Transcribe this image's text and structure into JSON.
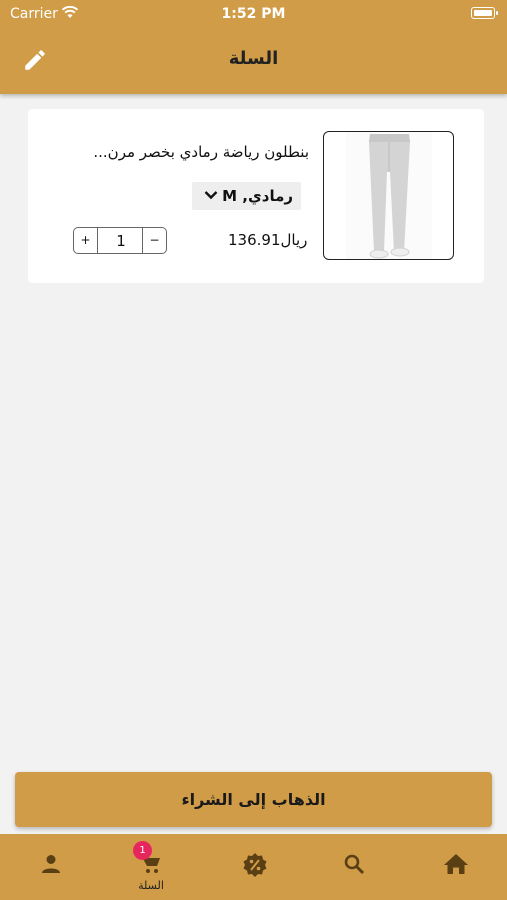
{
  "status_bar": {
    "carrier": "Carrier",
    "time": "1:52 PM"
  },
  "header": {
    "title": "السلة"
  },
  "cart": {
    "items": [
      {
        "name": "بنطلون رياضة رمادي بخصر مرن...",
        "variant": "رمادي, M",
        "price": "136.91ريال",
        "quantity": "1",
        "plus_label": "+",
        "minus_label": "−"
      }
    ]
  },
  "checkout": {
    "label": "الذهاب إلى الشراء"
  },
  "tabbar": {
    "items": [
      {
        "name": "profile",
        "label": ""
      },
      {
        "name": "cart",
        "label": "السلة",
        "badge": "1",
        "active": true
      },
      {
        "name": "offers",
        "label": ""
      },
      {
        "name": "search",
        "label": ""
      },
      {
        "name": "home",
        "label": ""
      }
    ]
  },
  "colors": {
    "brand": "#d09c47",
    "badge": "#e8265e",
    "background": "#f2f2f2"
  },
  "icons": [
    "wifi-icon",
    "battery-icon",
    "edit-icon",
    "chevron-down-icon",
    "user-icon",
    "cart-icon",
    "discount-icon",
    "search-icon",
    "home-icon"
  ]
}
